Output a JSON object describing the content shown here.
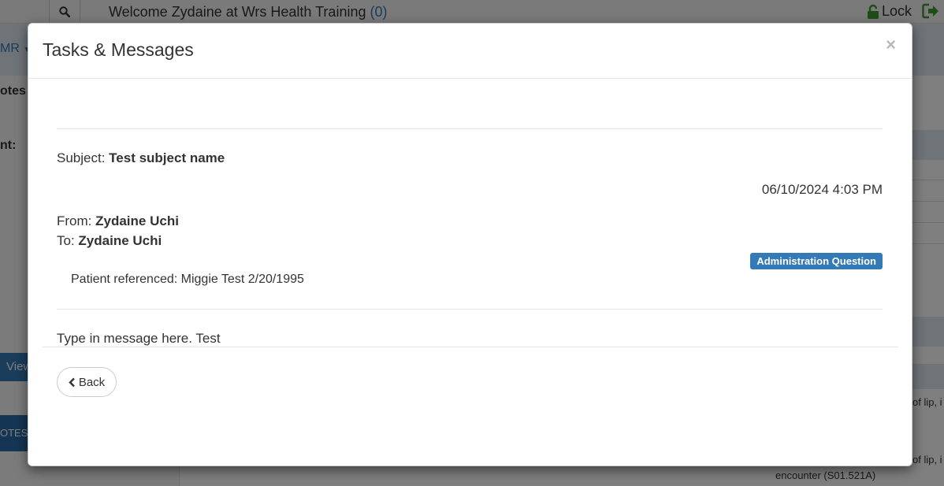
{
  "background": {
    "welcome_text": "Welcome Zydaine at Wrs Health Training",
    "welcome_count": "(0)",
    "lock_label": "Lock",
    "emr_label": "MR",
    "notes_label": "otes",
    "ent_label": "nt:",
    "view_label": "View",
    "otes_button": "OTES",
    "lip_text_1": "of lip, i",
    "lip_text_2": "of lip, i",
    "encounter_text": "encounter (S01.521A)"
  },
  "modal": {
    "title": "Tasks & Messages",
    "close_symbol": "×",
    "subject_label": "Subject:",
    "subject_value": "Test subject name",
    "timestamp": "06/10/2024 4:03 PM",
    "from_label": "From:",
    "from_value": "Zydaine Uchi",
    "to_label": "To:",
    "to_value": "Zydaine Uchi",
    "category_badge": "Administration Question",
    "patient_referenced": "Patient referenced: Miggie Test 2/20/1995",
    "message_body": "Type in message here. Test",
    "back_label": "Back"
  },
  "colors": {
    "accent": "#337ab7",
    "lock_green": "#3c9a2f"
  },
  "icons": [
    "search-icon",
    "lock-icon",
    "logout-icon",
    "close-icon",
    "chevron-left-icon"
  ]
}
